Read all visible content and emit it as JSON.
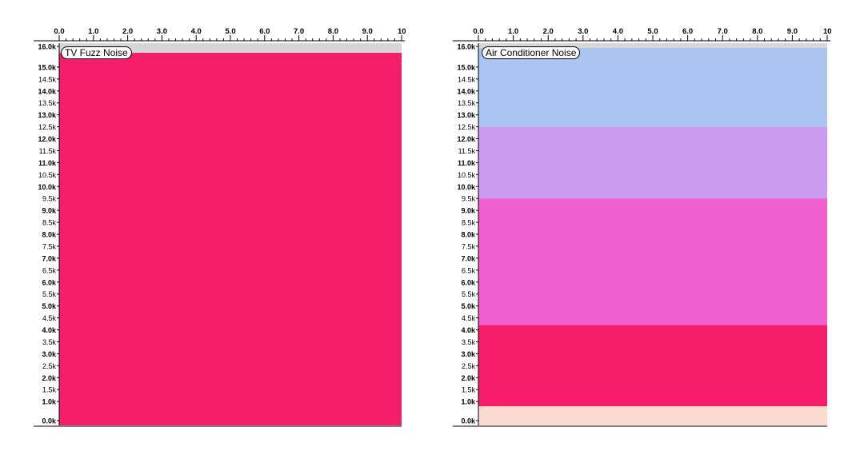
{
  "chart_data": [
    {
      "type": "heatmap",
      "title": "TV Fuzz Noise",
      "xlim": [
        0,
        10
      ],
      "x_ticks": [
        "0.0",
        "1.0",
        "2.0",
        "3.0",
        "4.0",
        "5.0",
        "6.0",
        "7.0",
        "8.0",
        "9.0",
        "10"
      ],
      "ylim": [
        0,
        16000
      ],
      "y_ticks": [
        "0.0k",
        "1.0k",
        "1.5k",
        "2.0k",
        "2.5k",
        "3.0k",
        "3.5k",
        "4.0k",
        "4.5k",
        "5.0k",
        "5.5k",
        "6.0k",
        "6.5k",
        "7.0k",
        "7.5k",
        "8.0k",
        "8.5k",
        "9.0k",
        "9.5k",
        "10.0k",
        "10.5k",
        "11.0k",
        "11.5k",
        "12.0k",
        "12.5k",
        "13.0k",
        "13.5k",
        "14.0k",
        "14.5k",
        "15.0k",
        "16.0k"
      ],
      "bands": [
        {
          "from_khz": 0,
          "to_khz": 15.6,
          "level": "high",
          "color": "#f2154f"
        },
        {
          "from_khz": 15.6,
          "to_khz": 16,
          "level": "none",
          "color": "#c0c0c0"
        }
      ]
    },
    {
      "type": "heatmap",
      "title": "Air Conditioner Noise",
      "xlim": [
        0,
        10
      ],
      "x_ticks": [
        "0.0",
        "1.0",
        "2.0",
        "3.0",
        "4.0",
        "5.0",
        "6.0",
        "7.0",
        "8.0",
        "9.0",
        "10"
      ],
      "ylim": [
        0,
        16000
      ],
      "y_ticks": [
        "0.0k",
        "1.0k",
        "1.5k",
        "2.0k",
        "2.5k",
        "3.0k",
        "3.5k",
        "4.0k",
        "4.5k",
        "5.0k",
        "5.5k",
        "6.0k",
        "6.5k",
        "7.0k",
        "7.5k",
        "8.0k",
        "8.5k",
        "9.0k",
        "9.5k",
        "10.0k",
        "10.5k",
        "11.0k",
        "11.5k",
        "12.0k",
        "12.5k",
        "13.0k",
        "13.5k",
        "14.0k",
        "14.5k",
        "15.0k",
        "16.0k"
      ],
      "bands": [
        {
          "from_khz": 0,
          "to_khz": 0.8,
          "level": "highest",
          "color": "#f6c8b8"
        },
        {
          "from_khz": 0.8,
          "to_khz": 4.2,
          "level": "high",
          "color": "#f2154f"
        },
        {
          "from_khz": 4.2,
          "to_khz": 9.5,
          "level": "medium",
          "color": "#e846b4"
        },
        {
          "from_khz": 9.5,
          "to_khz": 12.5,
          "level": "low-medium",
          "color": "#b073ea"
        },
        {
          "from_khz": 12.5,
          "to_khz": 15.8,
          "level": "low",
          "color": "#7fa6ee"
        },
        {
          "from_khz": 15.8,
          "to_khz": 16,
          "level": "none",
          "color": "#c0c0c0"
        }
      ]
    }
  ]
}
